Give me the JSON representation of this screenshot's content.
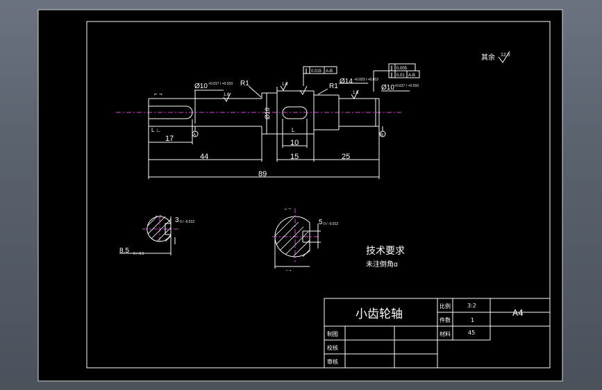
{
  "drawing": {
    "dims": {
      "d10_left": "Ø10",
      "d10_left_tol": "+0.017 / +0.010",
      "d18": "Ø18",
      "d14": "Ø14",
      "d14_tol": "+0.023 / +0.012",
      "d10_right": "Ø10",
      "d10_right_tol": "+0.017 / +0.010",
      "r1_left": "R1",
      "r1_right": "R1",
      "len17": "17",
      "len44": "44",
      "len10": "10",
      "len15": "15",
      "len25": "25",
      "len89": "89",
      "key_left": "3",
      "key_left_tol": "0 / -0.012",
      "key_left_depth": "8.5",
      "key_left_depth_tol": "0 / -0.2",
      "key_right": "5",
      "key_right_tol": "0 / -0.012"
    },
    "gdt": {
      "upper_left": [
        "0.015",
        "A-B"
      ],
      "upper_right_row1": [
        "0.005"
      ],
      "upper_right_row2": [
        "0.01",
        "A-B"
      ]
    },
    "datum_a": "A",
    "datum_b": "B",
    "roughness": {
      "remaining_label": "其余",
      "remaining_value": "12.5",
      "surface": "1.6"
    },
    "notes": {
      "heading": "技术要求",
      "line1": "未注倒角α"
    }
  },
  "title_block": {
    "part_name": "小齿轮轴",
    "scale_label": "比例",
    "scale_value": "3:2",
    "qty_label": "件数",
    "qty_value": "1",
    "material_label": "材料",
    "material_value": "45",
    "sheet_size": "A4",
    "drawn_by_label": "制图",
    "checked_by_label": "校核",
    "approved_by_label": "审核"
  },
  "colors": {
    "background": "#5a616c",
    "paper": "#000000",
    "line": "#ffffff",
    "centerline": "#e23ee2"
  }
}
